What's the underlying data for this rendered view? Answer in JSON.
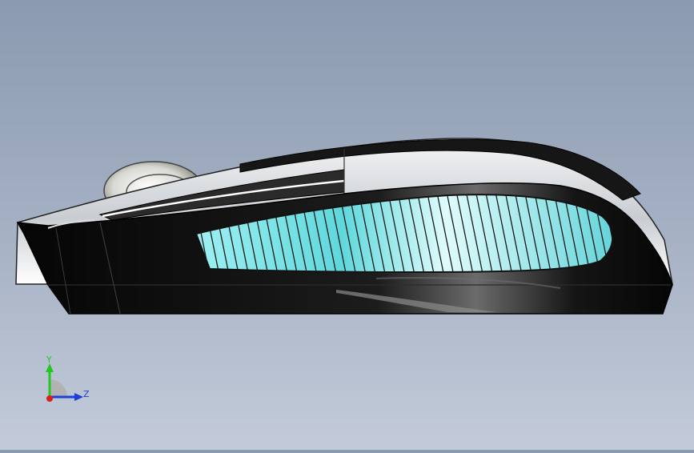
{
  "viewport": {
    "background_top": "#8b9ab0",
    "background_bottom": "#c3cbd9"
  },
  "model": {
    "body_color": "#0b0b0b",
    "shell_color": "#e9ebee",
    "vent_color": "#7fe7ea",
    "wheel_color": "#dcdcd6"
  },
  "triad": {
    "y_label": "Y",
    "z_label": "Z",
    "y_color": "#22c81f",
    "z_color": "#1f3fd8",
    "x_color": "#d81f1f"
  }
}
